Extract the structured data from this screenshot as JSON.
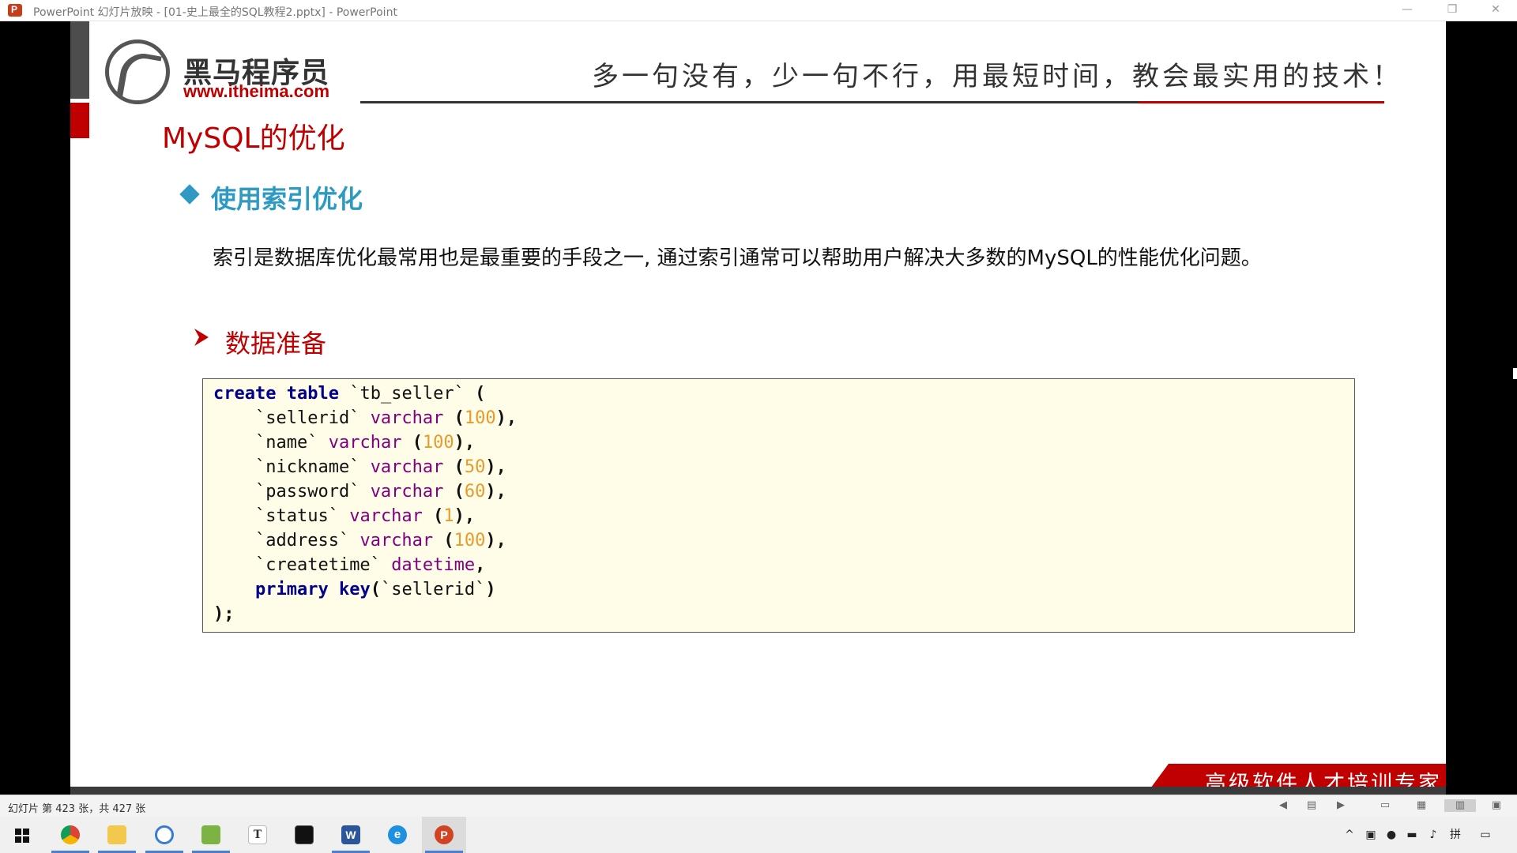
{
  "window": {
    "title": "PowerPoint 幻灯片放映 - [01-史上最全的SQL教程2.pptx] - PowerPoint",
    "minimize_glyph": "—",
    "restore_glyph": "❐",
    "close_glyph": "✕"
  },
  "slide": {
    "logo_name": "黑马程序员",
    "logo_url": "www.itheima.com",
    "slogan": "多一句没有，少一句不行，用最短时间，教会最实用的技术！",
    "title": "MySQL的优化",
    "section_heading": "使用索引优化",
    "paragraph": "索引是数据库优化最常用也是最重要的手段之一, 通过索引通常可以帮助用户解决大多数的MySQL的性能优化问题。",
    "sub_heading": "数据准备",
    "brand_tagline": "高级软件人才培训专家",
    "code": {
      "keywords": [
        "create",
        "table",
        "primary",
        "key"
      ],
      "table_name": "`tb_seller`",
      "columns": [
        {
          "name": "`sellerid`",
          "type": "varchar",
          "size": "100"
        },
        {
          "name": "`name`",
          "type": "varchar",
          "size": "100"
        },
        {
          "name": "`nickname`",
          "type": "varchar",
          "size": "50"
        },
        {
          "name": "`password`",
          "type": "varchar",
          "size": "60"
        },
        {
          "name": "`status`",
          "type": "varchar",
          "size": "1"
        },
        {
          "name": "`address`",
          "type": "varchar",
          "size": "100"
        },
        {
          "name": "`createtime`",
          "type": "datetime",
          "size": ""
        }
      ],
      "primary_key_column": "`sellerid`",
      "closing": ");"
    }
  },
  "statusbar": {
    "slide_info": "幻灯片 第 423 张，共 427 张"
  },
  "colors": {
    "brand_red": "#c00000",
    "heading_blue": "#2e9ac1",
    "code_background": "#fffde7",
    "keyword": "#00008b",
    "type": "#800080",
    "number": "#e89a2c"
  },
  "taskbar": {
    "apps": [
      "start-icon",
      "chrome-icon",
      "file-explorer-icon",
      "browser-icon",
      "image-editor-icon",
      "typora-icon",
      "terminal-icon",
      "word-icon",
      "edge-icon",
      "powerpoint-icon"
    ]
  }
}
